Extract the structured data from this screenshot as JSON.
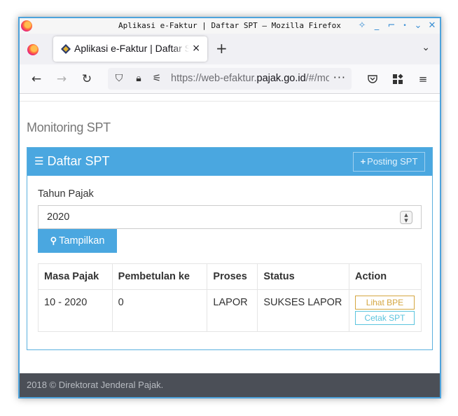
{
  "window": {
    "title": "Aplikasi e-Faktur | Daftar SPT — Mozilla Firefox"
  },
  "tab": {
    "title": "Aplikasi e-Faktur | Daftar SPT",
    "close": "×",
    "new_tab": "+"
  },
  "url": {
    "prefix": "https://web-efaktur.",
    "domain": "pajak.go.id",
    "suffix": "/#/monitoring"
  },
  "page": {
    "heading": "Monitoring SPT",
    "panel_title": "Daftar SPT",
    "posting_label": "Posting SPT",
    "tahun_label": "Tahun Pajak",
    "tahun_value": "2020",
    "tampilkan_label": "Tampilkan",
    "table": {
      "headers": [
        "Masa Pajak",
        "Pembetulan ke",
        "Proses",
        "Status",
        "Action"
      ],
      "rows": [
        {
          "masa": "10 - 2020",
          "pembetulan": "0",
          "proses": "LAPOR",
          "status": "SUKSES LAPOR",
          "actions": [
            "Lihat BPE",
            "Cetak SPT"
          ]
        }
      ]
    },
    "footer": "2018 © Direktorat Jenderal Pajak."
  },
  "icons": {
    "back": "back-arrow-icon",
    "forward": "forward-arrow-icon",
    "reload": "reload-icon",
    "shield": "shield-icon",
    "lock": "lock-icon",
    "permissions": "permissions-icon",
    "pocket": "pocket-icon",
    "extensions": "extensions-icon",
    "menu": "hamburger-menu-icon"
  },
  "colors": {
    "primary": "#4aa7e0",
    "warning": "#d4a640",
    "info": "#5bc4de",
    "footer": "#4b4f57"
  }
}
